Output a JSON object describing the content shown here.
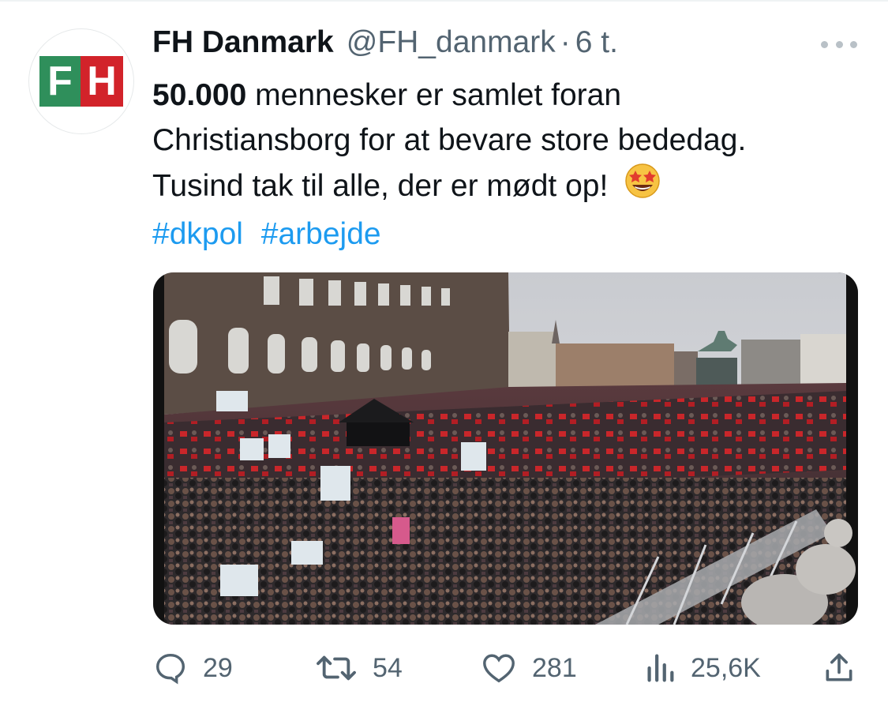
{
  "tweet": {
    "author_name": "FH Danmark",
    "author_handle": "@FH_danmark",
    "separator": "·",
    "time": "6 t.",
    "avatar": {
      "icon": "fh-logo",
      "letters": [
        "F",
        "H"
      ],
      "colors": [
        "#2f8f5b",
        "#d2232a"
      ]
    },
    "text": {
      "bold_number": "50.000",
      "line1_rest": "mennesker er samlet foran",
      "line2": "Christiansborg for at bevare store bededag.",
      "line3": "Tusind tak til alle, der er mødt op!",
      "emoji": "star-struck-emoji"
    },
    "hashtags": [
      "#dkpol",
      "#arbejde"
    ],
    "media": {
      "icon": "crowd-photo"
    },
    "stats": {
      "replies": "29",
      "retweets": "54",
      "likes": "281",
      "views": "25,6K"
    }
  },
  "colors": {
    "link": "#1d9bf0",
    "secondary_text": "#536471",
    "primary_text": "#0f1419"
  }
}
